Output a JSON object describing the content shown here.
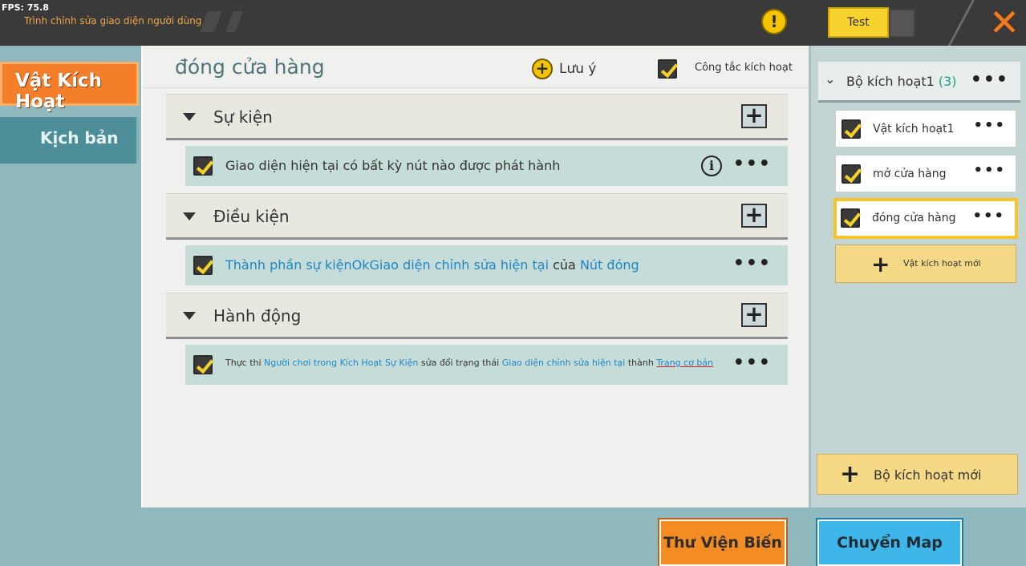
{
  "topbar": {
    "fps": "FPS: 75.8",
    "editor_title": "Trình chỉnh sửa giao diện người dùng",
    "warning_symbol": "!",
    "test_label": "Test",
    "close_symbol": "✕"
  },
  "sidebar": {
    "items": [
      {
        "label": "Vật Kích Hoạt",
        "active": true
      },
      {
        "label": "Kịch bản",
        "active": false
      }
    ]
  },
  "main": {
    "title": "đóng cửa hàng",
    "note_label": "Lưu ý",
    "switch_label": "Công tắc kích hoạt",
    "switch_checked": true,
    "sections": [
      {
        "label": "Sự kiện",
        "rows": [
          {
            "text": "Giao diện hiện tại có bất kỳ nút nào được phát hành",
            "has_info": true
          }
        ]
      },
      {
        "label": "Điều kiện",
        "rows": [
          {
            "part1": "Thành phần sự kiệnOkGiao diện chỉnh sửa hiện tại",
            "part2": " của ",
            "part3": "Nút đóng"
          }
        ]
      },
      {
        "label": "Hành động",
        "rows": [
          {
            "p1": "Thực thi ",
            "p2": "Người chơi trong Kích Hoạt Sự Kiện",
            "p3": " sửa đổi trạng thái ",
            "p4": "Giao diện chỉnh sửa hiện tại",
            "p5": " thành ",
            "p6": "Trang cơ bản"
          }
        ]
      }
    ],
    "add_symbol": "+",
    "more_symbol": "•••",
    "info_symbol": "i"
  },
  "right_panel": {
    "group_label": "Bộ kích hoạt1",
    "group_count": "(3)",
    "triggers": [
      {
        "label": "Vật kích hoạt1",
        "selected": false
      },
      {
        "label": "mở cửa hàng",
        "selected": false
      },
      {
        "label": "đóng cửa hàng",
        "selected": true
      }
    ],
    "new_trigger_label": "Vật kích hoạt mới",
    "new_group_label": "Bộ kích hoạt mới"
  },
  "bottom": {
    "library_button": "Thư Viện Biến Số",
    "map_button": "Chuyển Map"
  },
  "colors": {
    "accent_orange": "#f47e2a",
    "link_blue": "#1f86c4",
    "checkbox_yellow": "#f5d22a",
    "map_blue": "#3eb6ea"
  },
  "icons": [
    "warning-icon",
    "close-icon",
    "plus-circle-icon",
    "checkbox-icon",
    "triangle-down-icon",
    "plus-icon",
    "info-icon",
    "more-icon",
    "chevron-down-icon"
  ]
}
